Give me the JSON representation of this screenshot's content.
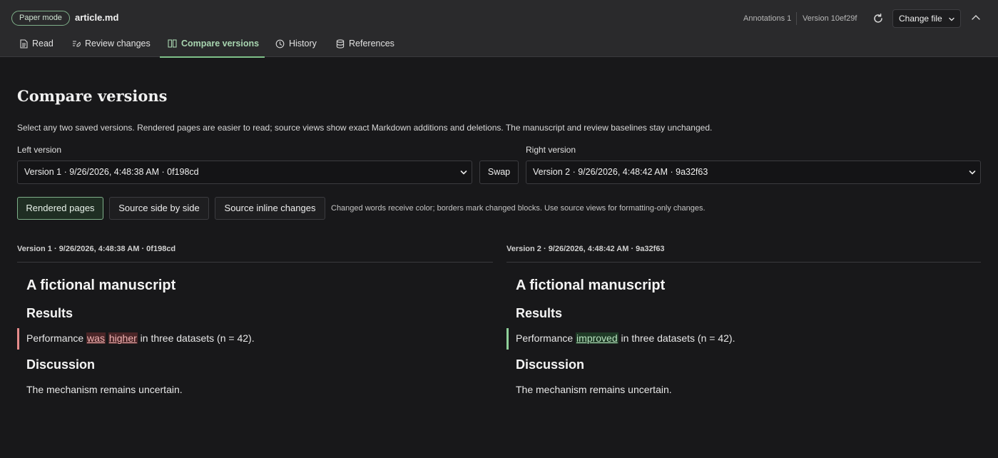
{
  "header": {
    "mode_badge": "Paper mode",
    "file_name": "article.md",
    "annotations": "Annotations 1",
    "version": "Version 10ef29f",
    "change_file_label": "Change file"
  },
  "tabs": [
    {
      "label": "Read",
      "icon": "document-icon"
    },
    {
      "label": "Review changes",
      "icon": "edit-icon"
    },
    {
      "label": "Compare versions",
      "icon": "columns-icon",
      "active": true
    },
    {
      "label": "History",
      "icon": "clock-icon"
    },
    {
      "label": "References",
      "icon": "database-icon"
    }
  ],
  "main": {
    "title": "Compare versions",
    "description": "Select any two saved versions. Rendered pages are easier to read; source views show exact Markdown additions and deletions. The manuscript and review baselines stay unchanged.",
    "left_label": "Left version",
    "right_label": "Right version",
    "left_selected": "Version 1 · 9/26/2026, 4:48:38 AM · 0f198cd",
    "right_selected": "Version 2 · 9/26/2026, 4:48:42 AM · 9a32f63",
    "swap_label": "Swap",
    "views": [
      {
        "label": "Rendered pages",
        "active": true
      },
      {
        "label": "Source side by side"
      },
      {
        "label": "Source inline changes"
      }
    ],
    "view_hint": "Changed words receive color; borders mark changed blocks. Use source views for formatting-only changes."
  },
  "left_doc": {
    "heading": "Version 1 · 9/26/2026, 4:48:38 AM · 0f198cd",
    "h1": "A fictional manuscript",
    "h2_results": "Results",
    "p_results_pre": "Performance ",
    "p_results_del1": "was",
    "p_results_space": " ",
    "p_results_del2": "higher",
    "p_results_post": " in three datasets (n = 42).",
    "h2_discussion": "Discussion",
    "p_discussion": "The mechanism remains uncertain."
  },
  "right_doc": {
    "heading": "Version 2 · 9/26/2026, 4:48:42 AM · 9a32f63",
    "h1": "A fictional manuscript",
    "h2_results": "Results",
    "p_results_pre": "Performance ",
    "p_results_ins": "improved",
    "p_results_post": " in three datasets (n = 42).",
    "h2_discussion": "Discussion",
    "p_discussion": "The mechanism remains uncertain."
  },
  "colors": {
    "accent": "#7fc089",
    "deletion": "#e58a8a",
    "insertion": "#8fd09a"
  }
}
